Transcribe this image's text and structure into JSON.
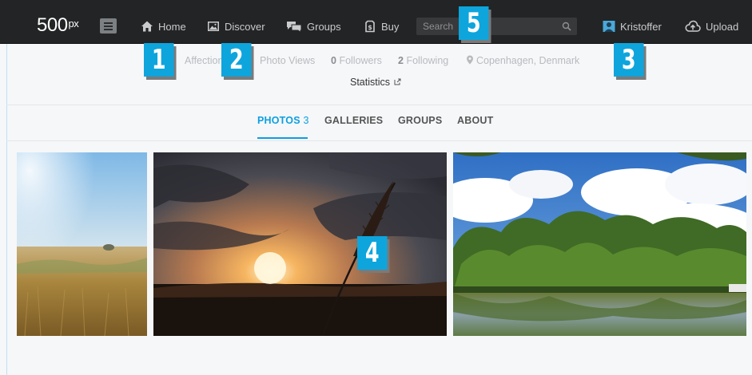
{
  "app": {
    "logo_text": "500",
    "logo_sup": "px"
  },
  "nav": {
    "home": "Home",
    "discover": "Discover",
    "groups": "Groups",
    "buy": "Buy",
    "search_placeholder": "Search",
    "user": "Kristoffer",
    "upload": "Upload"
  },
  "profile": {
    "affection_label": "Affection",
    "photo_views_label": "Photo Views",
    "followers_count": "0",
    "followers_label": "Followers",
    "following_count": "2",
    "following_label": "Following",
    "location": "Copenhagen, Denmark",
    "statistics_link": "Statistics"
  },
  "tabs": [
    {
      "label": "PHOTOS",
      "count": "3",
      "active": true
    },
    {
      "label": "GALLERIES"
    },
    {
      "label": "GROUPS"
    },
    {
      "label": "ABOUT"
    }
  ],
  "callouts": [
    "1",
    "2",
    "3",
    "4",
    "5"
  ],
  "colors": {
    "topbar": "#222425",
    "accent": "#0c9fe0",
    "callout": "#0ea5dd"
  },
  "icons": {
    "home": "home-icon",
    "discover": "image-icon",
    "groups": "chat-bubbles-icon",
    "buy": "price-tag-icon",
    "search": "magnifier-icon",
    "user": "user-avatar-icon",
    "upload": "cloud-upload-icon",
    "location": "map-pin-icon",
    "external": "external-link-icon"
  }
}
